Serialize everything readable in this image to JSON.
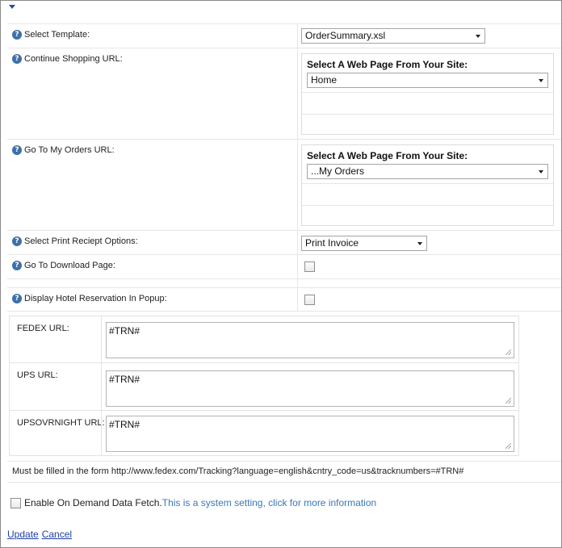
{
  "form": {
    "select_template": {
      "label": "Select Template:",
      "value": "OrderSummary.xsl"
    },
    "continue_shopping": {
      "label": "Continue Shopping URL:",
      "picker_title": "Select A Web Page From Your Site:",
      "value": "Home"
    },
    "my_orders": {
      "label": "Go To My Orders URL:",
      "picker_title": "Select A Web Page From Your Site:",
      "value": "...My Orders"
    },
    "print_receipt": {
      "label": "Select Print Reciept Options:",
      "value": "Print Invoice"
    },
    "download_page": {
      "label": "Go To Download Page:",
      "checked": false
    },
    "hotel_popup": {
      "label": "Display Hotel Reservation In Popup:",
      "checked": false
    }
  },
  "tracking_urls": [
    {
      "label": "FEDEX URL:",
      "value": "#TRN#"
    },
    {
      "label": "UPS URL:",
      "value": "#TRN#"
    },
    {
      "label": "UPSOVRNIGHT URL:",
      "value": "#TRN#"
    }
  ],
  "hint": "Must be filled in the form http://www.fedex.com/Tracking?language=english&cntry_code=us&tracknumbers=#TRN#",
  "on_demand": {
    "label": "Enable On Demand Data Fetch.",
    "info_link": "This is a system setting, click for more information",
    "checked": false
  },
  "actions": {
    "update": "Update",
    "cancel": "Cancel"
  }
}
